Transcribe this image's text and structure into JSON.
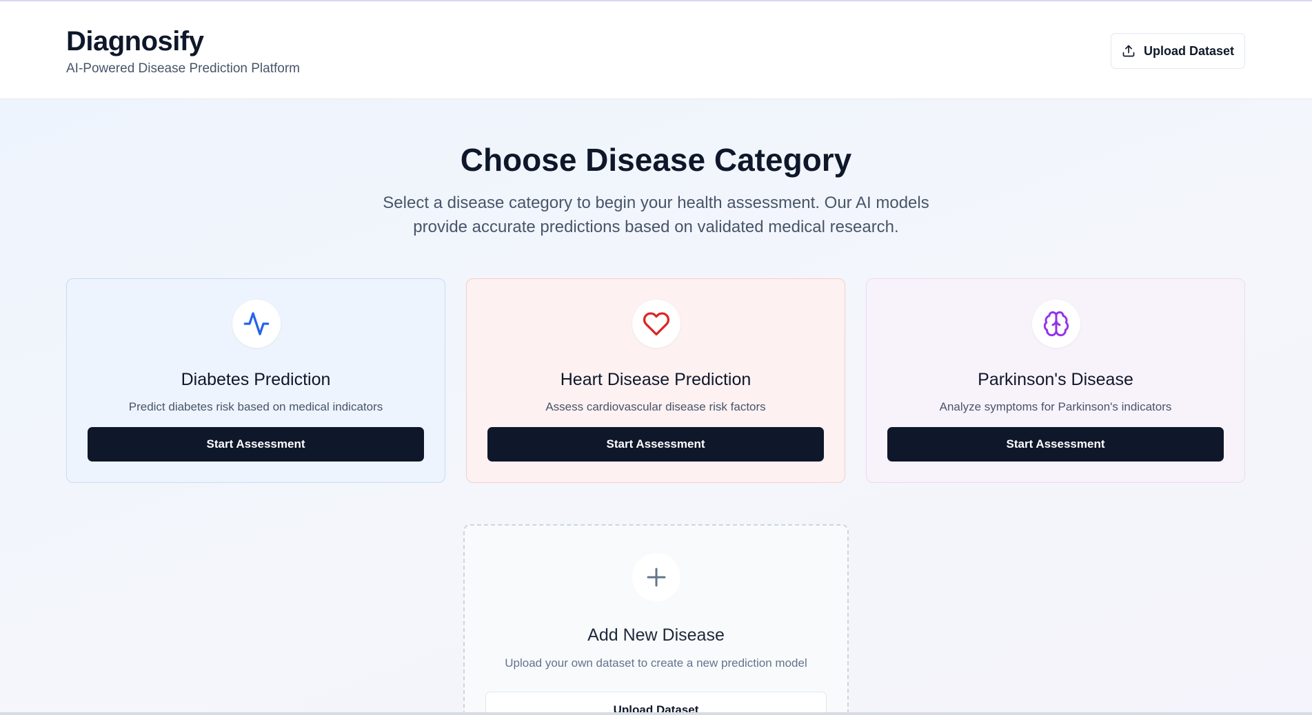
{
  "header": {
    "title": "Diagnosify",
    "subtitle": "AI-Powered Disease Prediction Platform",
    "upload_label": "Upload Dataset",
    "upload_icon": "upload-icon"
  },
  "main": {
    "heading": "Choose Disease Category",
    "subtitle": "Select a disease category to begin your health assessment. Our AI models provide accurate predictions based on validated medical research."
  },
  "cards": [
    {
      "title": "Diabetes Prediction",
      "description": "Predict diabetes risk based on medical indicators",
      "button": "Start Assessment",
      "icon": "activity-icon",
      "color": "#2563eb"
    },
    {
      "title": "Heart Disease Prediction",
      "description": "Assess cardiovascular disease risk factors",
      "button": "Start Assessment",
      "icon": "heart-icon",
      "color": "#dc2626"
    },
    {
      "title": "Parkinson's Disease",
      "description": "Analyze symptoms for Parkinson's indicators",
      "button": "Start Assessment",
      "icon": "brain-icon",
      "color": "#9333ea"
    }
  ],
  "add_card": {
    "title": "Add New Disease",
    "description": "Upload your own dataset to create a new prediction model",
    "button": "Upload Dataset",
    "icon": "plus-icon"
  }
}
